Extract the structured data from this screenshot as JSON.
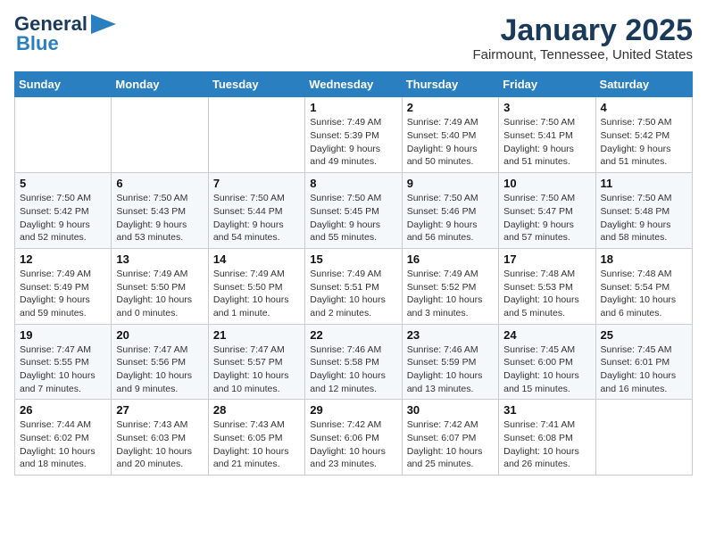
{
  "header": {
    "logo_general": "General",
    "logo_blue": "Blue",
    "month": "January 2025",
    "location": "Fairmount, Tennessee, United States"
  },
  "weekdays": [
    "Sunday",
    "Monday",
    "Tuesday",
    "Wednesday",
    "Thursday",
    "Friday",
    "Saturday"
  ],
  "weeks": [
    [
      null,
      null,
      null,
      {
        "day": 1,
        "sunrise": "7:49 AM",
        "sunset": "5:39 PM",
        "daylight": "9 hours and 49 minutes."
      },
      {
        "day": 2,
        "sunrise": "7:49 AM",
        "sunset": "5:40 PM",
        "daylight": "9 hours and 50 minutes."
      },
      {
        "day": 3,
        "sunrise": "7:50 AM",
        "sunset": "5:41 PM",
        "daylight": "9 hours and 51 minutes."
      },
      {
        "day": 4,
        "sunrise": "7:50 AM",
        "sunset": "5:42 PM",
        "daylight": "9 hours and 51 minutes."
      }
    ],
    [
      {
        "day": 5,
        "sunrise": "7:50 AM",
        "sunset": "5:42 PM",
        "daylight": "9 hours and 52 minutes."
      },
      {
        "day": 6,
        "sunrise": "7:50 AM",
        "sunset": "5:43 PM",
        "daylight": "9 hours and 53 minutes."
      },
      {
        "day": 7,
        "sunrise": "7:50 AM",
        "sunset": "5:44 PM",
        "daylight": "9 hours and 54 minutes."
      },
      {
        "day": 8,
        "sunrise": "7:50 AM",
        "sunset": "5:45 PM",
        "daylight": "9 hours and 55 minutes."
      },
      {
        "day": 9,
        "sunrise": "7:50 AM",
        "sunset": "5:46 PM",
        "daylight": "9 hours and 56 minutes."
      },
      {
        "day": 10,
        "sunrise": "7:50 AM",
        "sunset": "5:47 PM",
        "daylight": "9 hours and 57 minutes."
      },
      {
        "day": 11,
        "sunrise": "7:50 AM",
        "sunset": "5:48 PM",
        "daylight": "9 hours and 58 minutes."
      }
    ],
    [
      {
        "day": 12,
        "sunrise": "7:49 AM",
        "sunset": "5:49 PM",
        "daylight": "9 hours and 59 minutes."
      },
      {
        "day": 13,
        "sunrise": "7:49 AM",
        "sunset": "5:50 PM",
        "daylight": "10 hours and 0 minutes."
      },
      {
        "day": 14,
        "sunrise": "7:49 AM",
        "sunset": "5:50 PM",
        "daylight": "10 hours and 1 minute."
      },
      {
        "day": 15,
        "sunrise": "7:49 AM",
        "sunset": "5:51 PM",
        "daylight": "10 hours and 2 minutes."
      },
      {
        "day": 16,
        "sunrise": "7:49 AM",
        "sunset": "5:52 PM",
        "daylight": "10 hours and 3 minutes."
      },
      {
        "day": 17,
        "sunrise": "7:48 AM",
        "sunset": "5:53 PM",
        "daylight": "10 hours and 5 minutes."
      },
      {
        "day": 18,
        "sunrise": "7:48 AM",
        "sunset": "5:54 PM",
        "daylight": "10 hours and 6 minutes."
      }
    ],
    [
      {
        "day": 19,
        "sunrise": "7:47 AM",
        "sunset": "5:55 PM",
        "daylight": "10 hours and 7 minutes."
      },
      {
        "day": 20,
        "sunrise": "7:47 AM",
        "sunset": "5:56 PM",
        "daylight": "10 hours and 9 minutes."
      },
      {
        "day": 21,
        "sunrise": "7:47 AM",
        "sunset": "5:57 PM",
        "daylight": "10 hours and 10 minutes."
      },
      {
        "day": 22,
        "sunrise": "7:46 AM",
        "sunset": "5:58 PM",
        "daylight": "10 hours and 12 minutes."
      },
      {
        "day": 23,
        "sunrise": "7:46 AM",
        "sunset": "5:59 PM",
        "daylight": "10 hours and 13 minutes."
      },
      {
        "day": 24,
        "sunrise": "7:45 AM",
        "sunset": "6:00 PM",
        "daylight": "10 hours and 15 minutes."
      },
      {
        "day": 25,
        "sunrise": "7:45 AM",
        "sunset": "6:01 PM",
        "daylight": "10 hours and 16 minutes."
      }
    ],
    [
      {
        "day": 26,
        "sunrise": "7:44 AM",
        "sunset": "6:02 PM",
        "daylight": "10 hours and 18 minutes."
      },
      {
        "day": 27,
        "sunrise": "7:43 AM",
        "sunset": "6:03 PM",
        "daylight": "10 hours and 20 minutes."
      },
      {
        "day": 28,
        "sunrise": "7:43 AM",
        "sunset": "6:05 PM",
        "daylight": "10 hours and 21 minutes."
      },
      {
        "day": 29,
        "sunrise": "7:42 AM",
        "sunset": "6:06 PM",
        "daylight": "10 hours and 23 minutes."
      },
      {
        "day": 30,
        "sunrise": "7:42 AM",
        "sunset": "6:07 PM",
        "daylight": "10 hours and 25 minutes."
      },
      {
        "day": 31,
        "sunrise": "7:41 AM",
        "sunset": "6:08 PM",
        "daylight": "10 hours and 26 minutes."
      },
      null
    ]
  ]
}
